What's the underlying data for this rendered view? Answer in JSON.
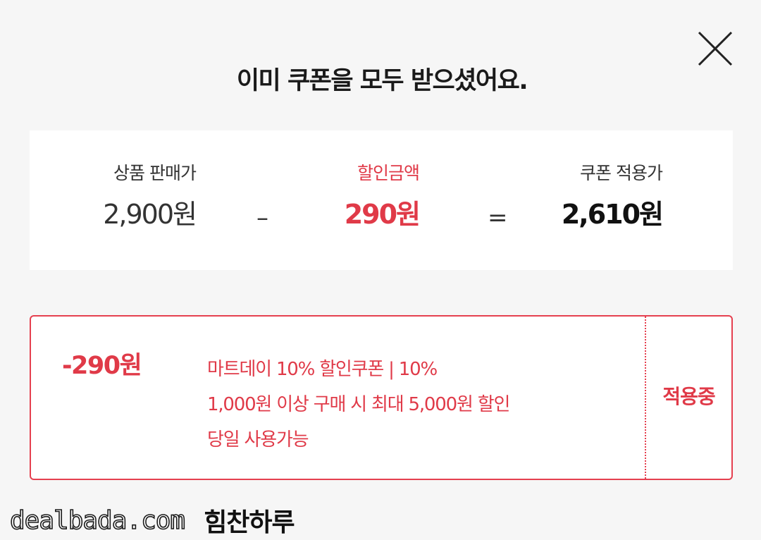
{
  "header": {
    "title": "이미 쿠폰을 모두 받으셨어요.",
    "close_icon": "close-icon"
  },
  "summary": {
    "price_label": "상품 판매가",
    "price_value": "2,900원",
    "minus_symbol": "–",
    "discount_label": "할인금액",
    "discount_value": "290원",
    "equals_symbol": "=",
    "final_label": "쿠폰 적용가",
    "final_value": "2,610원"
  },
  "coupon": {
    "amount": "-290원",
    "lines": [
      "마트데이 10% 할인쿠폰 | 10%",
      "1,000원 이상 구매 시 최대 5,000원 할인",
      "당일 사용가능"
    ],
    "status": "적용중"
  },
  "watermark": {
    "site": "dealbada.com",
    "name": "힘찬하루"
  },
  "colors": {
    "accent": "#e03a48",
    "background": "#f6f6f6",
    "card": "#ffffff",
    "text": "#222222"
  }
}
